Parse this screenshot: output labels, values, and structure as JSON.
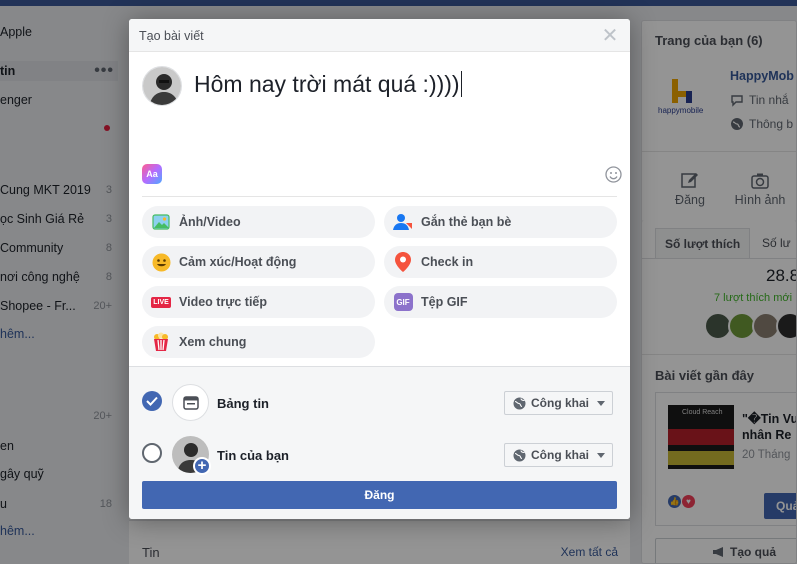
{
  "left_sidebar": {
    "items": [
      {
        "label": "Apple",
        "count": ""
      },
      {
        "label": "tin",
        "count": ""
      },
      {
        "label": "enger",
        "count": ""
      },
      {
        "label": "",
        "count": ""
      },
      {
        "label": "Cung MKT 2019",
        "count": "3"
      },
      {
        "label": "ọc Sinh Giá Rẻ",
        "count": "3"
      },
      {
        "label": "Community",
        "count": "8"
      },
      {
        "label": "nơi công nghệ",
        "count": "8"
      },
      {
        "label": "Shopee - Fr...",
        "count": "20+"
      },
      {
        "label": "hêm...",
        "count": ""
      },
      {
        "label": "",
        "count": "20+"
      },
      {
        "label": "en",
        "count": ""
      },
      {
        "label": "gây quỹ",
        "count": ""
      },
      {
        "label": "u",
        "count": "18"
      },
      {
        "label": "hêm...",
        "count": ""
      }
    ]
  },
  "center_feed": {
    "section_title": "Tin",
    "see_all": "Xem tất cả"
  },
  "right_sidebar": {
    "pages_title": "Trang của bạn (6)",
    "page_name": "HappyMob",
    "page_messages": "Tin nhắ",
    "page_notifications": "Thông b",
    "action_post": "Đăng",
    "action_photo": "Hình ảnh",
    "tab_likes": "Số lượt thích",
    "tab_other": "Số lư",
    "likes_count": "28.8",
    "likes_this_week": "7 lượt thích mới",
    "recent_posts_title": "Bài viết gần đây",
    "recent_post_title_line1": "\"�Tin Vu",
    "recent_post_title_line2": "nhân Re",
    "recent_post_date": "20 Tháng",
    "recent_post_thumb_text": "Cloud Reach",
    "boost_button": "Quả",
    "create_ad": "Tạo quả"
  },
  "dialog": {
    "title": "Tạo bài viết",
    "composer_text": "Hôm nay trời mát quá :))))",
    "bg_picker_label": "Aa",
    "actions": [
      {
        "label": "Ảnh/Video",
        "icon": "photo-video-icon"
      },
      {
        "label": "Gắn thẻ bạn bè",
        "icon": "tag-friends-icon"
      },
      {
        "label": "Cảm xúc/Hoạt động",
        "icon": "feeling-icon"
      },
      {
        "label": "Check in",
        "icon": "location-pin-icon"
      },
      {
        "label": "Video trực tiếp",
        "icon": "live-video-icon"
      },
      {
        "label": "Tệp GIF",
        "icon": "gif-icon"
      },
      {
        "label": "Xem chung",
        "icon": "watch-party-icon"
      }
    ],
    "live_badge": "LIVE",
    "gif_badge": "GIF",
    "audience": [
      {
        "label": "Bảng tin",
        "privacy": "Công khai",
        "checked": true
      },
      {
        "label": "Tin của bạn",
        "privacy": "Công khai",
        "checked": false
      }
    ],
    "post_button": "Đăng"
  },
  "colors": {
    "brand_blue": "#4267b2",
    "topbar": "#3b5998",
    "pill_bg": "#f2f3f5",
    "likes_green": "#42b72a"
  }
}
